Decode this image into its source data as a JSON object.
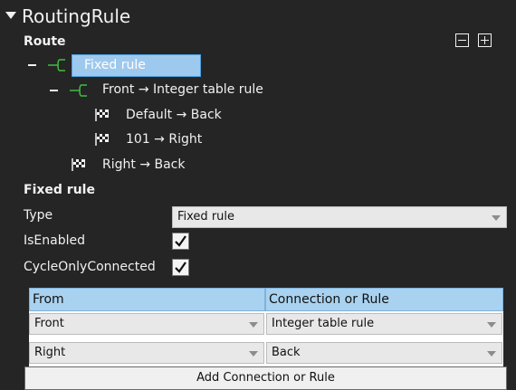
{
  "header": {
    "title": "RoutingRule"
  },
  "route": {
    "title": "Route",
    "collapse_all_icon": "minus-box-icon",
    "expand_all_icon": "plus-box-icon",
    "tree": {
      "root": {
        "label": "Fixed rule",
        "icon": "fork-icon",
        "selected": true
      },
      "child": {
        "label": "Front →  Integer table rule",
        "icon": "fork-icon"
      },
      "leaves": [
        {
          "label": "Default → Back",
          "icon": "checkered-flag-icon"
        },
        {
          "label": "101 → Right",
          "icon": "checkered-flag-icon"
        }
      ],
      "sibling": {
        "label": "Right → Back",
        "icon": "checkered-flag-icon"
      }
    }
  },
  "detail": {
    "title": "Fixed rule",
    "type_label": "Type",
    "type_value": "Fixed rule",
    "enabled_label": "IsEnabled",
    "enabled_checked": true,
    "cycle_label": "CycleOnlyConnected",
    "cycle_checked": true
  },
  "grid": {
    "columns": [
      "From",
      "Connection or Rule"
    ],
    "rows": [
      {
        "from": "Front",
        "to": "Integer table rule"
      },
      {
        "from": "Right",
        "to": "Back"
      }
    ],
    "add_label": "Add Connection or Rule"
  },
  "colors": {
    "background": "#252526",
    "selection": "#9ec9ee",
    "grid_header": "#a9d2f0",
    "fork_icon": "#3fbf3f"
  }
}
